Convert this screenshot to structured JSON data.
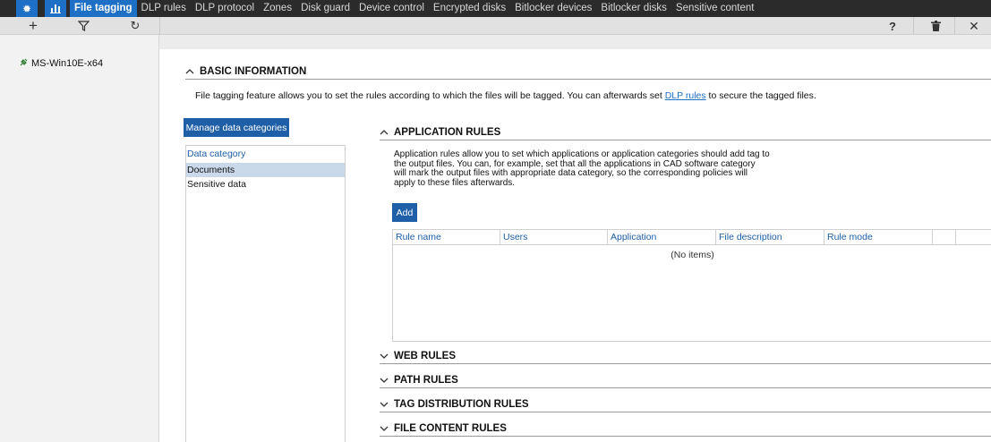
{
  "nav": {
    "tabs": [
      {
        "label": "File tagging",
        "active": true
      },
      {
        "label": "DLP rules"
      },
      {
        "label": "DLP protocol"
      },
      {
        "label": "Zones"
      },
      {
        "label": "Disk guard"
      },
      {
        "label": "Device control"
      },
      {
        "label": "Encrypted disks"
      },
      {
        "label": "Bitlocker devices"
      },
      {
        "label": "Bitlocker disks"
      },
      {
        "label": "Sensitive content"
      }
    ]
  },
  "toolbar": {
    "add_icon": "+",
    "filter_icon": "⛛",
    "refresh_icon": "↻",
    "help_icon": "?",
    "delete_icon": "🗑",
    "close_icon": "✕"
  },
  "tree": {
    "item_label": "MS-Win10E-x64"
  },
  "basic": {
    "title": "BASIC INFORMATION",
    "desc_before": "File tagging feature allows you to set the rules according to which the files will be tagged. You can afterwards set ",
    "desc_link": "DLP rules",
    "desc_after": " to secure the tagged files."
  },
  "categories": {
    "button": "Manage data categories",
    "header": "Data category",
    "items": [
      "Documents",
      "Sensitive data"
    ]
  },
  "app_rules": {
    "title": "APPLICATION RULES",
    "desc": "Application rules allow you to set which applications or application categories should add tag to the output files. You can, for example, set that all the applications in CAD software category will mark the output files with appropriate data category, so the corresponding policies will apply to these files afterwards.",
    "add_button": "Add",
    "columns": [
      "Rule name",
      "Users",
      "Application",
      "File description",
      "Rule mode",
      "",
      ""
    ],
    "empty_text": "(No items)"
  },
  "collapsed_sections": [
    "WEB RULES",
    "PATH RULES",
    "TAG DISTRIBUTION RULES",
    "FILE CONTENT RULES"
  ],
  "colors": {
    "accent": "#1e6fc6",
    "button": "#1e5fa8",
    "nav_bg": "#2b2b2b"
  }
}
